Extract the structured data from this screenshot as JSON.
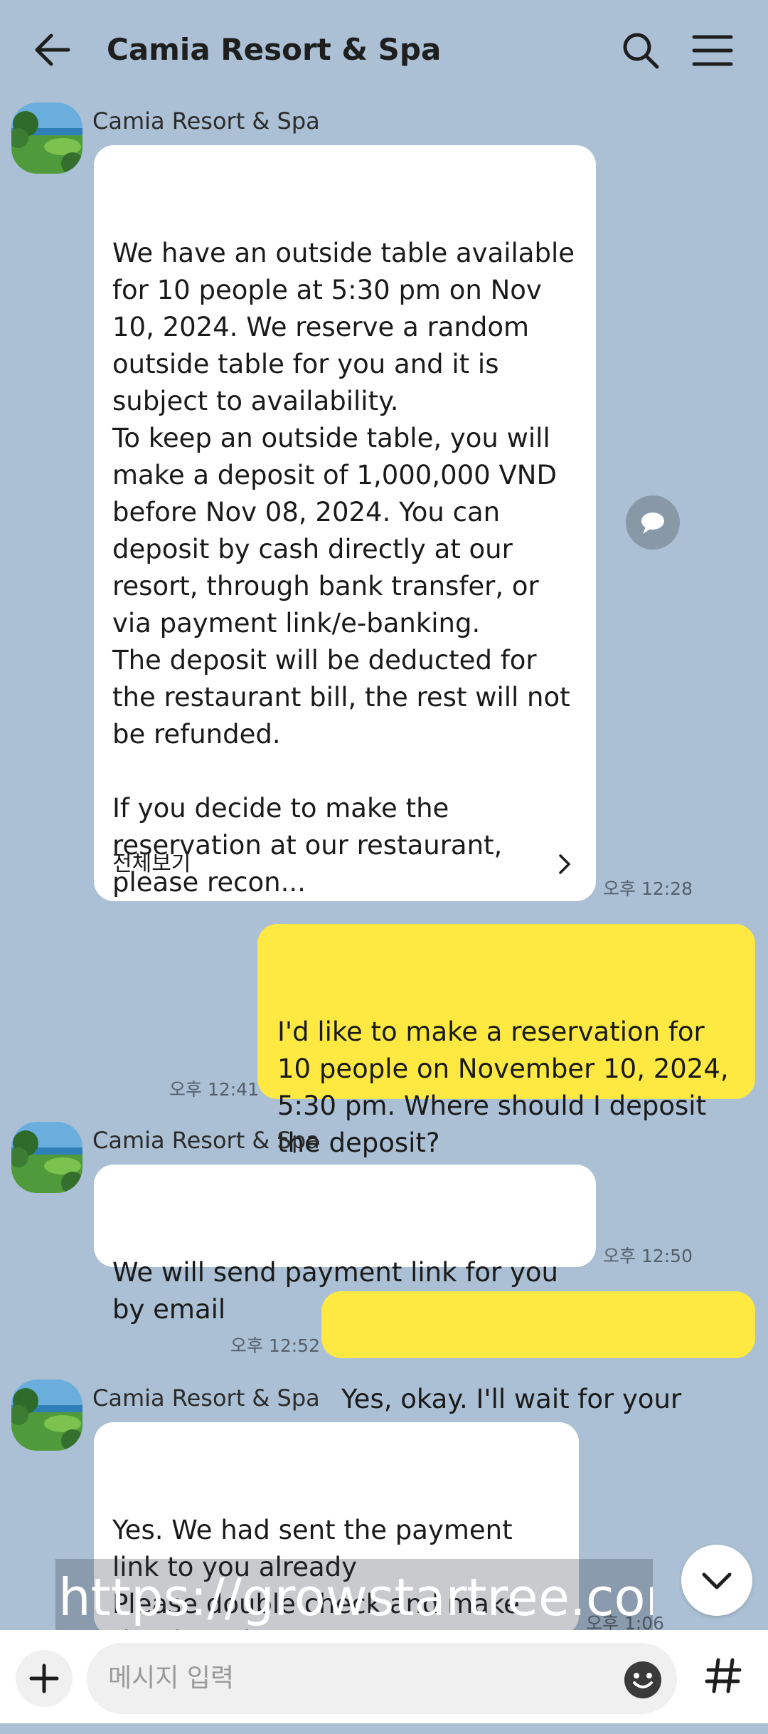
{
  "header": {
    "title": "Camia Resort & Spa"
  },
  "messages": [
    {
      "sender": "Camia Resort & Spa",
      "text": "We have an outside table available for 10 people at 5:30 pm on Nov 10, 2024. We reserve a random outside table for you and it is subject to availability.\nTo keep an outside table, you will make a deposit of 1,000,000 VND before Nov 08, 2024. You can deposit by cash directly at our resort, through bank transfer, or via payment link/e-banking.\nThe deposit will be deducted for the restaurant bill, the rest will not be refunded.\n\nIf you decide to make the reservation at our restaurant, please recon...",
      "see_all": "전체보기",
      "time": "오후 12:28"
    },
    {
      "text": "I'd like to make a reservation for 10 people on November 10, 2024, 5:30 pm. Where should I deposit the deposit?",
      "time": "오후 12:41"
    },
    {
      "sender": "Camia Resort & Spa",
      "text": "We will send payment link for you by email",
      "time": "오후 12:50"
    },
    {
      "text": "Yes, okay. I'll wait for your email",
      "time": "오후 12:52"
    },
    {
      "sender": "Camia Resort & Spa",
      "text": "Yes. We had sent the payment link to you already\nPlease double check and make the deposit\nThank you!",
      "time": "오후 1:06"
    }
  ],
  "watermark": "https://growstartree.com",
  "input": {
    "placeholder": "메시지 입력"
  },
  "colors": {
    "background": "#abc0d4",
    "incoming_bubble": "#ffffff",
    "outgoing_bubble": "#fee943"
  },
  "icons": [
    "back-arrow-icon",
    "search-icon",
    "menu-icon",
    "reply-bubble-icon",
    "chevron-down-icon",
    "plus-icon",
    "emoji-icon",
    "hash-icon"
  ]
}
